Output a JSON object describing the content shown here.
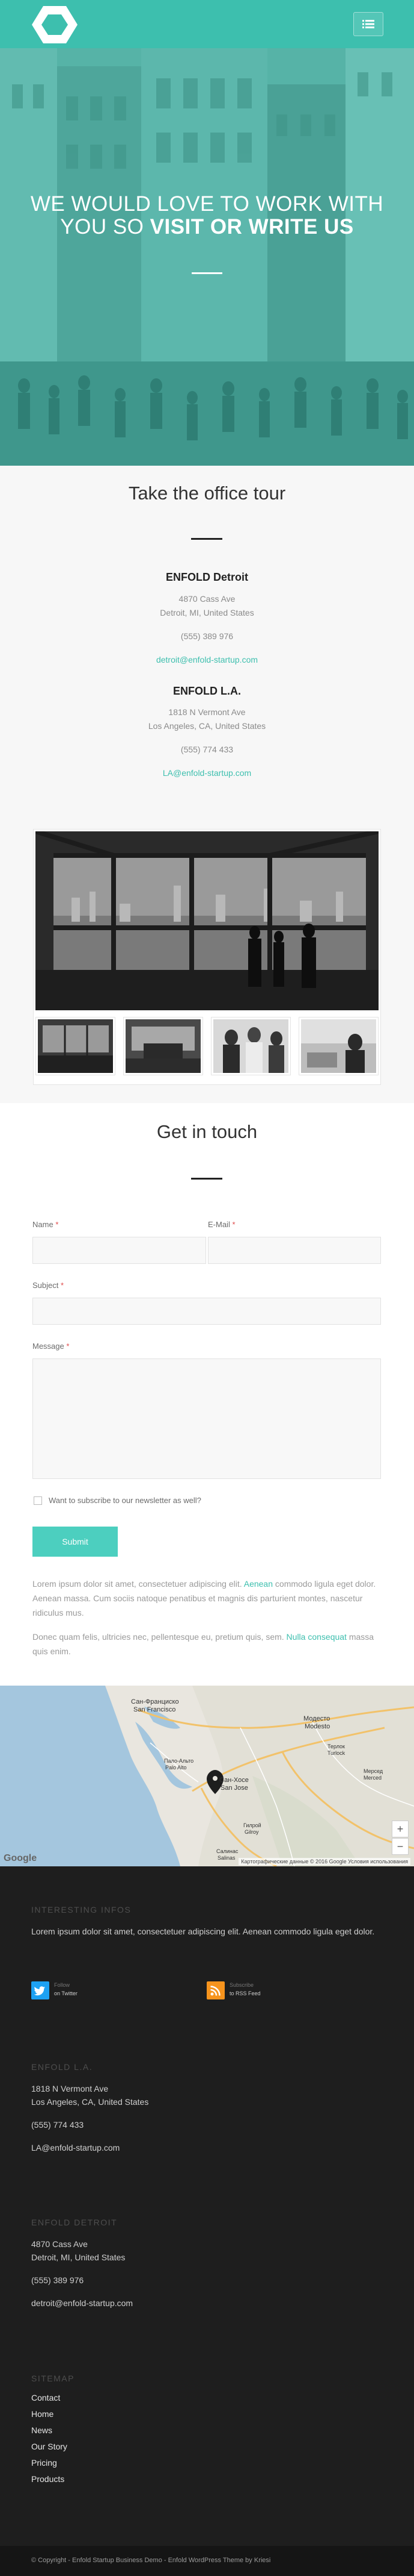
{
  "header": {
    "logo_icon": "hexagon-logo-icon",
    "menu_icon": "hamburger-menu-icon",
    "accent": "#3dbfae"
  },
  "hero": {
    "title_line1": "WE WOULD LOVE TO WORK WITH",
    "title_line2_plain": "YOU SO ",
    "title_line2_bold": "VISIT OR WRITE US"
  },
  "tour": {
    "title": "Take the office tour",
    "offices": [
      {
        "name": "ENFOLD Detroit",
        "address1": "4870 Cass Ave",
        "address2": "Detroit, MI, United States",
        "phone": "(555) 389 976",
        "email": "detroit@enfold-startup.com"
      },
      {
        "name": "ENFOLD L.A.",
        "address1": "1818 N Vermont Ave",
        "address2": "Los Angeles, CA, United States",
        "phone": "(555) 774 433",
        "email": "LA@enfold-startup.com"
      }
    ]
  },
  "contact": {
    "title": "Get in touch",
    "name_label": "Name",
    "email_label": "E-Mail",
    "subject_label": "Subject",
    "message_label": "Message",
    "required_mark": "*",
    "newsletter_label": "Want to subscribe to our newsletter as well?",
    "submit_label": "Submit",
    "para1_a": "Lorem ipsum dolor sit amet, consectetuer adipiscing elit. ",
    "para1_link": "Aenean",
    "para1_b": " commodo ligula eget dolor. Aenean massa. Cum sociis natoque penatibus et magnis dis parturient montes, nascetur ridiculus mus.",
    "para2_a": "Donec quam felis, ultricies nec, pellentesque eu, pretium quis, sem. ",
    "para2_link": "Nulla consequat",
    "para2_b": " massa quis enim."
  },
  "map": {
    "labels": {
      "sf": "Сан-Франциско",
      "sf_en": "San Francisco",
      "palo": "Пало-Альто",
      "palo_en": "Palo Alto",
      "sj": "Сан-Хосе",
      "sj_en": "San Jose",
      "modesto": "Модесто",
      "modesto_en": "Modesto",
      "turlock": "Терлок",
      "turlock_en": "Turlock",
      "merced": "Мерсед",
      "merced_en": "Merced",
      "gilroy": "Гилрой",
      "gilroy_en": "Gilroy",
      "salinas": "Салинас",
      "salinas_en": "Salinas"
    },
    "zoom_in": "+",
    "zoom_out": "−",
    "footer_text": "Картографические данные © 2016 Google   Условия использования",
    "brand": "Google"
  },
  "footer": {
    "info_heading": "INTERESTING INFOS",
    "info_text": "Lorem ipsum dolor sit amet, consectetuer adipiscing elit. Aenean commodo ligula eget dolor.",
    "twitter_top": "Follow",
    "twitter_bottom": "on Twitter",
    "rss_top": "Subscribe",
    "rss_bottom": "to RSS Feed",
    "la_heading": "ENFOLD L.A.",
    "la_addr1": "1818 N Vermont Ave",
    "la_addr2": "Los Angeles, CA, United States",
    "la_phone": "(555) 774 433",
    "la_email": "LA@enfold-startup.com",
    "det_heading": "ENFOLD DETROIT",
    "det_addr1": "4870 Cass Ave",
    "det_addr2": "Detroit, MI, United States",
    "det_phone": "(555) 389 976",
    "det_email": "detroit@enfold-startup.com",
    "sitemap_heading": "SITEMAP",
    "sitemap": [
      "Contact",
      "Home",
      "News",
      "Our Story",
      "Pricing",
      "Products"
    ],
    "copyright": "© Copyright - Enfold Startup Business Demo - Enfold WordPress Theme by Kriesi"
  }
}
